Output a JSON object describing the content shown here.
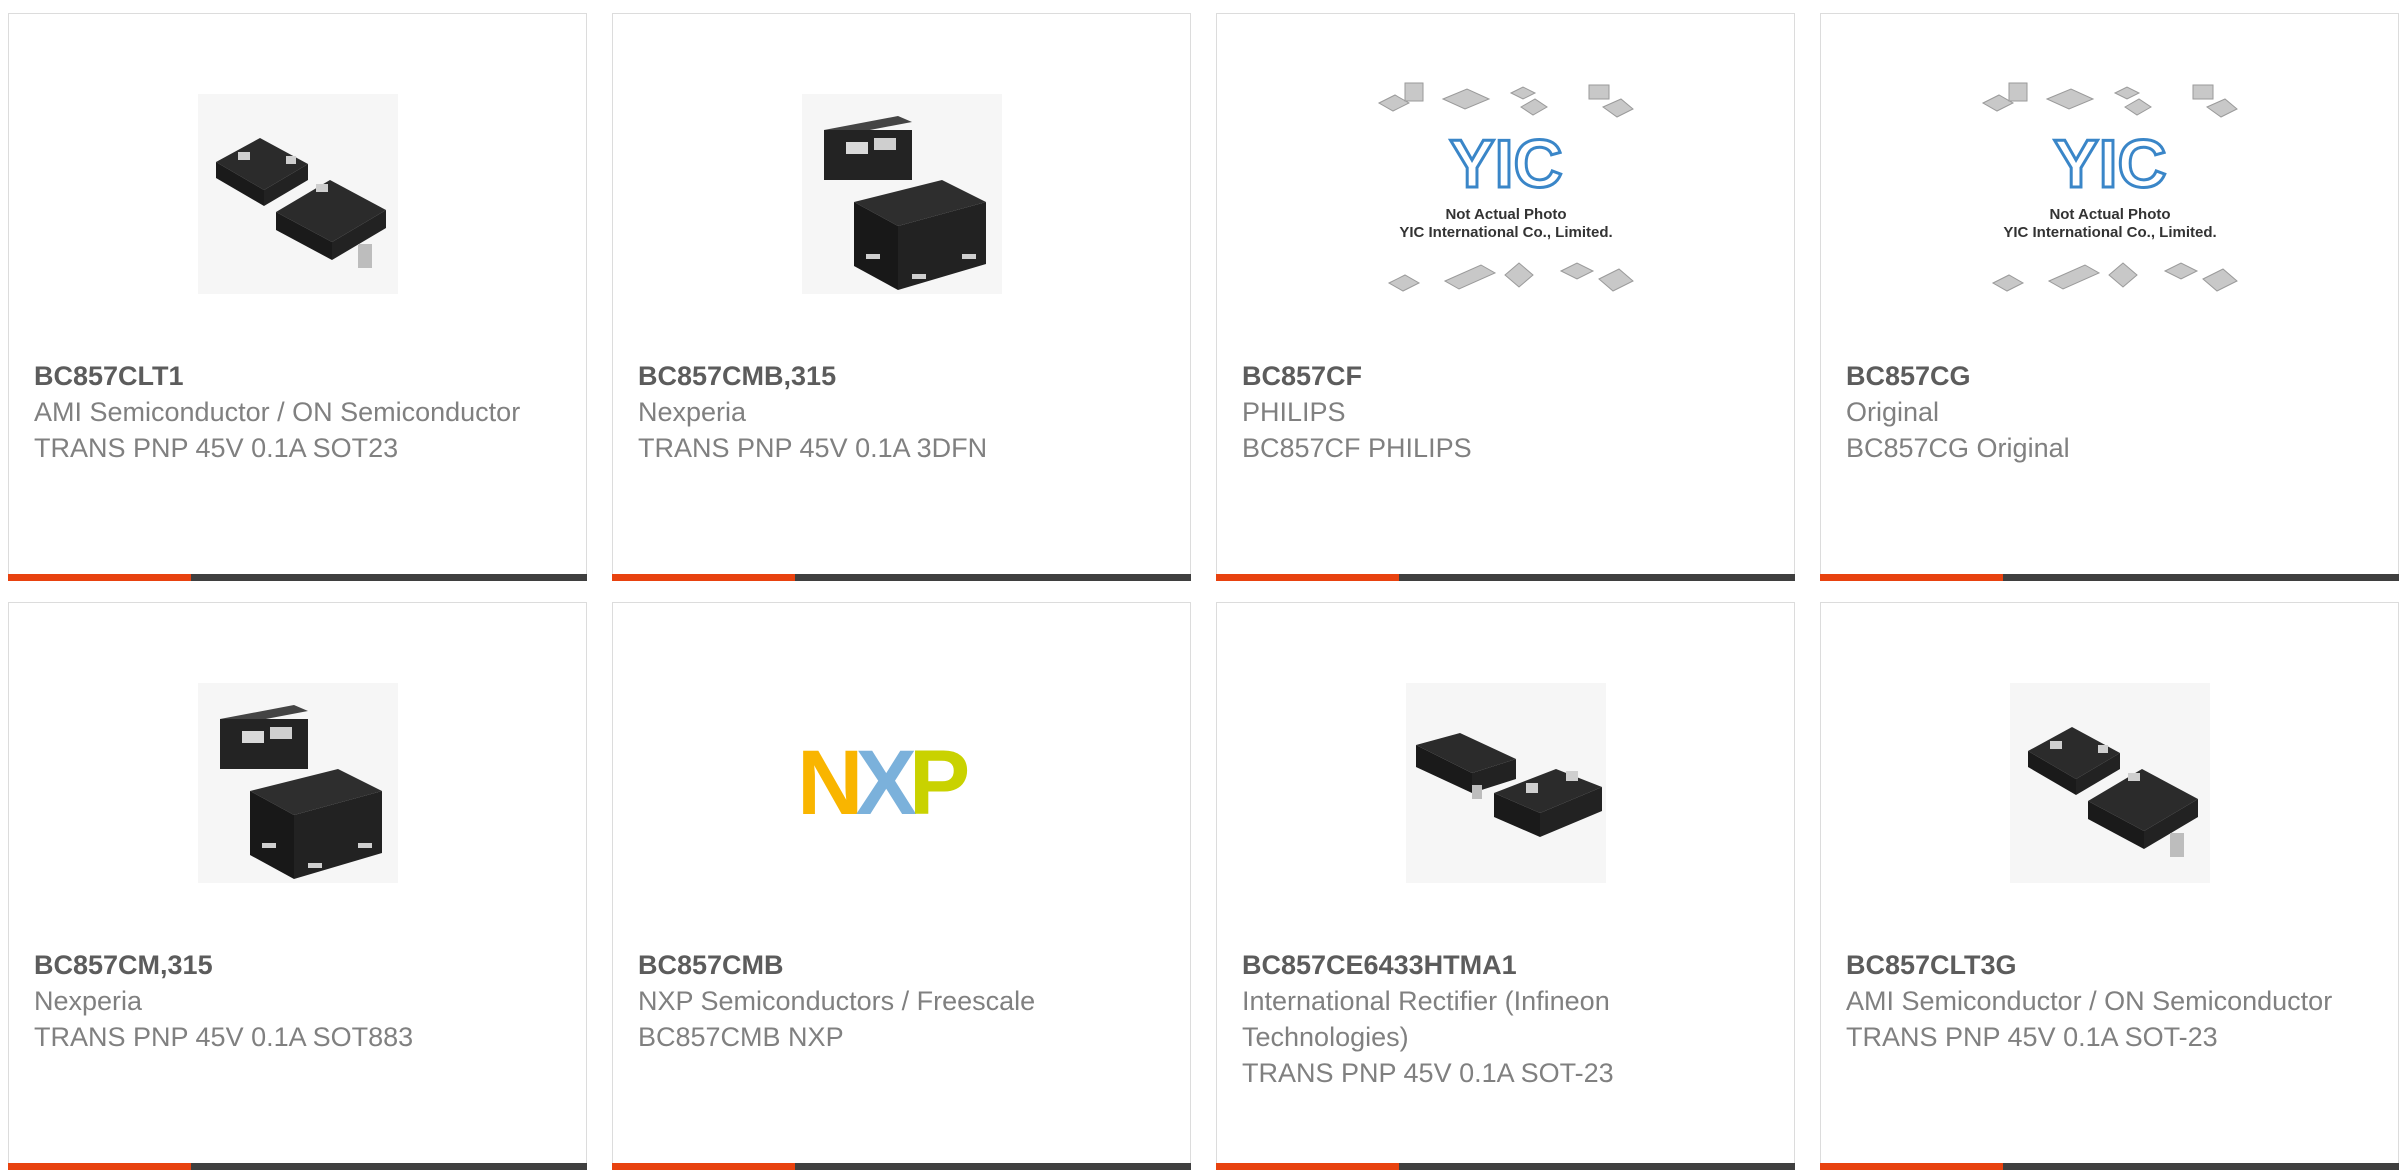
{
  "accent_color": "#e8420f",
  "bar_color": "#3f3f3f",
  "products": [
    {
      "part": "BC857CLT1",
      "manufacturer": "AMI Semiconductor / ON Semiconductor",
      "description": "TRANS PNP 45V 0.1A SOT23",
      "image": "sot23-package-icon"
    },
    {
      "part": "BC857CMB,315",
      "manufacturer": "Nexperia",
      "description": "TRANS PNP 45V 0.1A 3DFN",
      "image": "dfn-package-icon"
    },
    {
      "part": "BC857CF",
      "manufacturer": "PHILIPS",
      "description": "BC857CF PHILIPS",
      "image": "yic-placeholder-image",
      "placeholder": {
        "logo": "YIC",
        "line1": "Not Actual Photo",
        "line2": "YIC International Co., Limited."
      }
    },
    {
      "part": "BC857CG",
      "manufacturer": "Original",
      "description": "BC857CG Original",
      "image": "yic-placeholder-image",
      "placeholder": {
        "logo": "YIC",
        "line1": "Not Actual Photo",
        "line2": "YIC International Co., Limited."
      }
    },
    {
      "part": "BC857CM,315",
      "manufacturer": "Nexperia",
      "description": "TRANS PNP 45V 0.1A SOT883",
      "image": "dfn-package-icon"
    },
    {
      "part": "BC857CMB",
      "manufacturer": "NXP Semiconductors / Freescale",
      "description": "BC857CMB NXP",
      "image": "nxp-logo",
      "logo_text": "NXP",
      "logo_colors": [
        "#f9b500",
        "#7bb1db",
        "#c9d200"
      ]
    },
    {
      "part": "BC857CE6433HTMA1",
      "manufacturer": "International Rectifier (Infineon Technologies)",
      "description": "TRANS PNP 45V 0.1A SOT-23",
      "image": "sot23-package-icon"
    },
    {
      "part": "BC857CLT3G",
      "manufacturer": "AMI Semiconductor / ON Semiconductor",
      "description": "TRANS PNP 45V 0.1A SOT-23",
      "image": "sot23-package-icon"
    }
  ]
}
